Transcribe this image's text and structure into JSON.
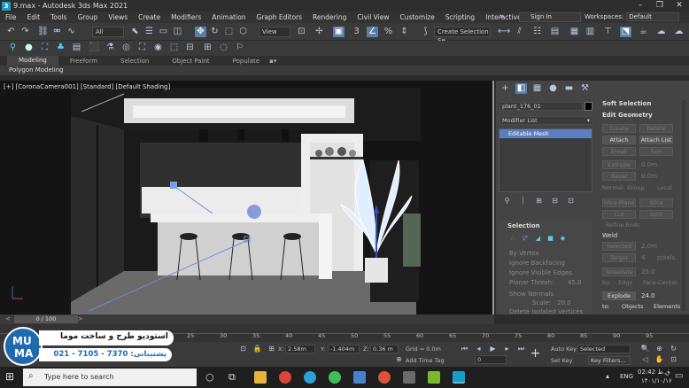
{
  "title_bar": {
    "app_title": "9.max - Autodesk 3ds Max 2021",
    "minimize": "–",
    "restore": "❐",
    "close": "✕"
  },
  "menu": [
    "File",
    "Edit",
    "Tools",
    "Group",
    "Views",
    "Create",
    "Modifiers",
    "Animation",
    "Graph Editors",
    "Rendering",
    "Civil View",
    "Customize",
    "Scripting",
    "Interactive"
  ],
  "sign_in": "Sign In",
  "workspaces": {
    "label": "Workspaces:",
    "value": "Default"
  },
  "toolbar": {
    "selection_filter": "All",
    "view_dropdown": "View",
    "create_selection_set": "Create Selection Se"
  },
  "ribbon": {
    "tabs": [
      "Modeling",
      "Freeform",
      "Selection",
      "Object Paint",
      "Populate"
    ],
    "active": "Modeling",
    "sub_label": "Polygon Modeling"
  },
  "viewport": {
    "label": "[+] [CoronaCamera001] [Standard] [Default Shading]"
  },
  "command_panel": {
    "object_name": "plant_176_01",
    "modifier_list": "Modifier List",
    "stack_item": "Editable Mesh",
    "selection_title": "Selection",
    "selection_options": [
      "By Vertex",
      "Ignore Backfacing",
      "Ignore Visible Edges"
    ],
    "planar_thresh": "Planar Thresh:",
    "planar_value": "45.0",
    "show_normals": "Show Normals",
    "scale_label": "Scale:",
    "scale_value": "20.0",
    "delete_isolated": "Delete Isolated Vertices",
    "soft_selection": "Soft Selection",
    "edit_geometry": "Edit Geometry",
    "buttons": {
      "create": "Create",
      "delete": "Delete",
      "attach": "Attach",
      "attach_list": "Attach List",
      "break": "Break",
      "turn": "Turn",
      "extrude": "Extrude",
      "bevel": "Bevel",
      "slice_plane": "Slice Plane",
      "slice": "Slice",
      "cut": "Cut",
      "split": "Split",
      "refine_ends": "Refine Ends",
      "selected": "Selected",
      "target": "Target",
      "tessellate": "Tessellate",
      "explode": "Explode"
    },
    "extrude_value": "0.0m",
    "bevel_value": "0.0m",
    "normal_label": "Normal:",
    "group_label": "Group",
    "local_label": "Local",
    "weld_label": "Weld",
    "selected_value": "2.0m",
    "target_value": "4",
    "pixels_label": "pixels",
    "tessellate_value": "25.0",
    "by_label": "by:",
    "edge_label": "Edge",
    "face_center_label": "Face-Center",
    "explode_value": "24.0",
    "to_label": "to:",
    "objects_label": "Objects",
    "elements_label": "Elements"
  },
  "timeline": {
    "frame_counter": "0 / 100",
    "ticks": [
      "25",
      "30",
      "35",
      "40",
      "45",
      "50",
      "55",
      "60",
      "65",
      "70",
      "75",
      "80",
      "85",
      "90",
      "95"
    ]
  },
  "status": {
    "x_label": "X:",
    "x_value": "2.58m",
    "y_label": "Y:",
    "y_value": "-1.404m",
    "z_label": "Z:",
    "z_value": "0.36 m",
    "grid": "Grid = 0.0m",
    "add_time_tag": "Add Time Tag",
    "auto_key": "Auto Key",
    "set_key": "Set Key",
    "selected_dropdown": "Selected",
    "key_filters": "Key Filters...",
    "frame_value": "0"
  },
  "promo": {
    "logo_top": "MU",
    "logo_bottom": "MA",
    "title": "استودیو طرح و ساخت موما",
    "support": "پشتیبانی: 7370 - 7105 - 021"
  },
  "taskbar": {
    "search_placeholder": "Type here to search",
    "lang": "ENG",
    "time": "02:42 ق.ظ",
    "date": "۱۴۰۱/۱۰/۱۶"
  }
}
